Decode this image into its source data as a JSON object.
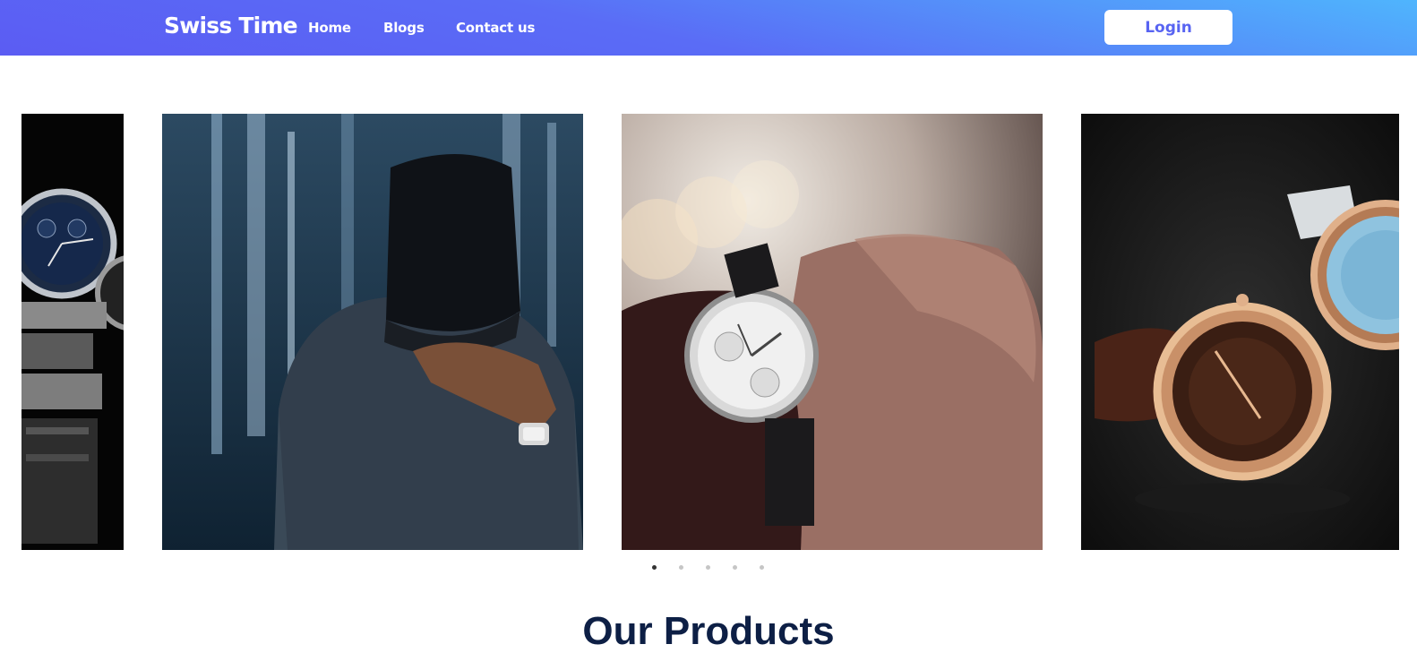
{
  "navbar": {
    "brand": "Swiss Time",
    "links": [
      "Home",
      "Blogs",
      "Contact us"
    ],
    "login_label": "Login"
  },
  "carousel": {
    "slides": [
      {
        "subject": "silver-chronograph-watches"
      },
      {
        "subject": "man-in-cap-wearing-watch"
      },
      {
        "subject": "wrist-with-silver-watch"
      },
      {
        "subject": "rose-gold-watches"
      }
    ],
    "active_dot": 1,
    "dot_count": 5
  },
  "products": {
    "title": "Our Products"
  },
  "colors": {
    "navbar_start": "#5b5cf3",
    "navbar_end": "#4fb5fd",
    "accent": "#5864f2",
    "title": "#0d1f45"
  }
}
